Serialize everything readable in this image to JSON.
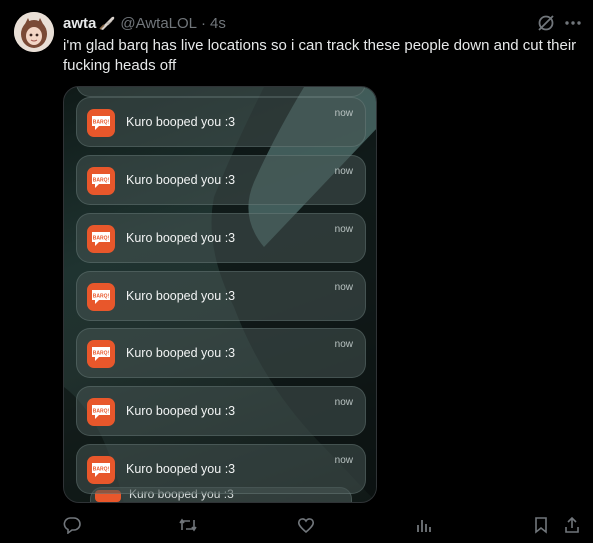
{
  "tweet": {
    "author_name": "awta",
    "name_emoji": "feather-emoji",
    "handle": "@AwtaLOL",
    "separator": "·",
    "time": "4s",
    "text": "i'm glad barq has live locations so i can track these people down and cut their fucking heads off"
  },
  "media": {
    "app_icon_text": "BARQ!",
    "notifications": [
      {
        "text": "Kuro booped you :3",
        "time": "now"
      },
      {
        "text": "Kuro booped you :3",
        "time": "now"
      },
      {
        "text": "Kuro booped you :3",
        "time": "now"
      },
      {
        "text": "Kuro booped you :3",
        "time": "now"
      },
      {
        "text": "Kuro booped you :3",
        "time": "now"
      },
      {
        "text": "Kuro booped you :3",
        "time": "now"
      },
      {
        "text": "Kuro booped you :3",
        "time": "now"
      }
    ],
    "partial_notification_text": "Kuro booped you :3"
  },
  "actions": [
    "reply-icon",
    "retweet-icon",
    "like-icon",
    "views-icon",
    "bookmark-icon",
    "share-icon"
  ],
  "colors": {
    "background": "#000000",
    "text_primary": "#e7e9ea",
    "text_secondary": "#71767b",
    "barq_orange": "#e8572b"
  }
}
